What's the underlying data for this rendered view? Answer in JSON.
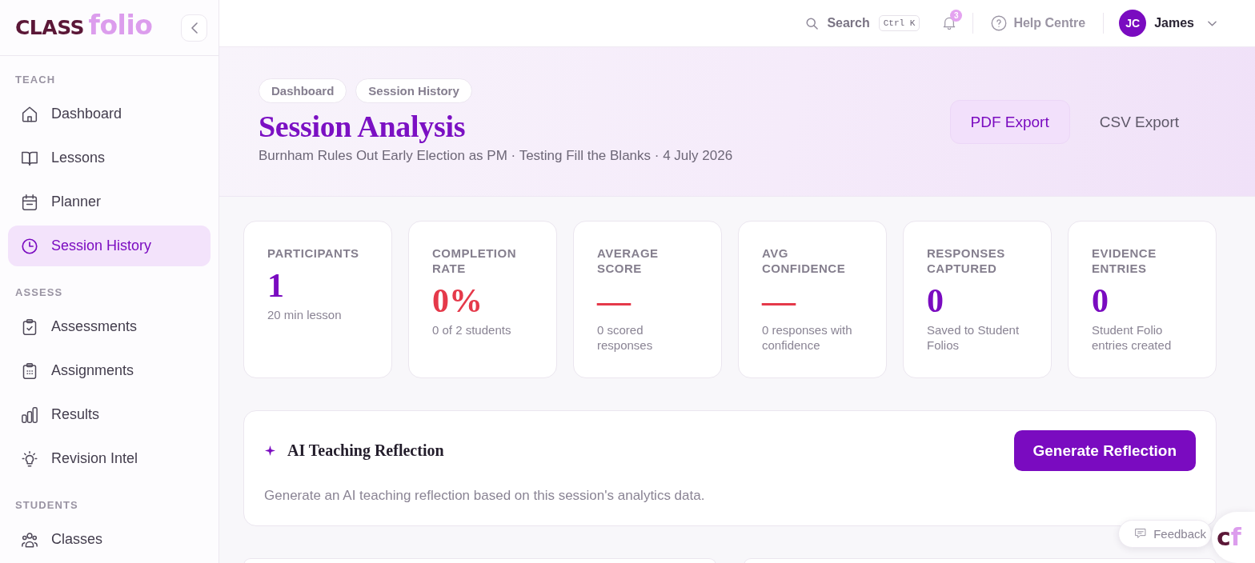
{
  "sidebar": {
    "logo": [
      "CLASS",
      "folio"
    ],
    "sections": [
      {
        "heading": "TEACH",
        "items": [
          {
            "label": "Dashboard",
            "selected": false
          },
          {
            "label": "Lessons",
            "selected": false
          },
          {
            "label": "Planner",
            "selected": false
          },
          {
            "label": "Session History",
            "selected": true
          }
        ]
      },
      {
        "heading": "ASSESS",
        "items": [
          {
            "label": "Assessments",
            "selected": false
          },
          {
            "label": "Assignments",
            "selected": false
          },
          {
            "label": "Results",
            "selected": false
          },
          {
            "label": "Revision Intel",
            "selected": false
          }
        ]
      },
      {
        "heading": "STUDENTS",
        "items": [
          {
            "label": "Classes",
            "selected": false
          }
        ]
      }
    ]
  },
  "topbar": {
    "search": {
      "label": "Search",
      "shortcut": "Ctrl K"
    },
    "notifications": {
      "count": "3"
    },
    "help": "Help Centre",
    "user": {
      "initials": "JC",
      "name": "James"
    }
  },
  "header": {
    "breadcrumbs": [
      "Dashboard",
      "Session History"
    ],
    "title": "Session Analysis",
    "subtitle": "Burnham Rules Out Early Election as PM · Testing Fill the Blanks · 4 July 2026",
    "actions": [
      {
        "label": "PDF Export",
        "kind": "tinted"
      },
      {
        "label": "CSV Export",
        "kind": "plain"
      }
    ]
  },
  "stats": [
    {
      "label": "PARTICIPANTS",
      "value": "1",
      "note": "20 min lesson",
      "color": "#7a0bc0"
    },
    {
      "label": "COMPLETION RATE",
      "value": "0%",
      "note": "0 of 2 students",
      "color": "#e5394a"
    },
    {
      "label": "AVERAGE SCORE",
      "value": "—",
      "note": "0 scored responses",
      "color": "#e5394a"
    },
    {
      "label": "AVG CONFIDENCE",
      "value": "—",
      "note": "0 responses with confidence",
      "color": "#e5394a"
    },
    {
      "label": "RESPONSES CAPTURED",
      "value": "0",
      "note": "Saved to Student Folios",
      "color": "#7a0bc0"
    },
    {
      "label": "EVIDENCE ENTRIES",
      "value": "0",
      "note": "Student Folio entries created",
      "color": "#7a0bc0"
    }
  ],
  "reflection": {
    "title": "AI Teaching Reflection",
    "button": "Generate Reflection",
    "description": "Generate an AI teaching reflection based on this session's analytics data."
  },
  "feedback": {
    "label": "Feedback"
  },
  "launcher": {
    "text": "cf"
  }
}
